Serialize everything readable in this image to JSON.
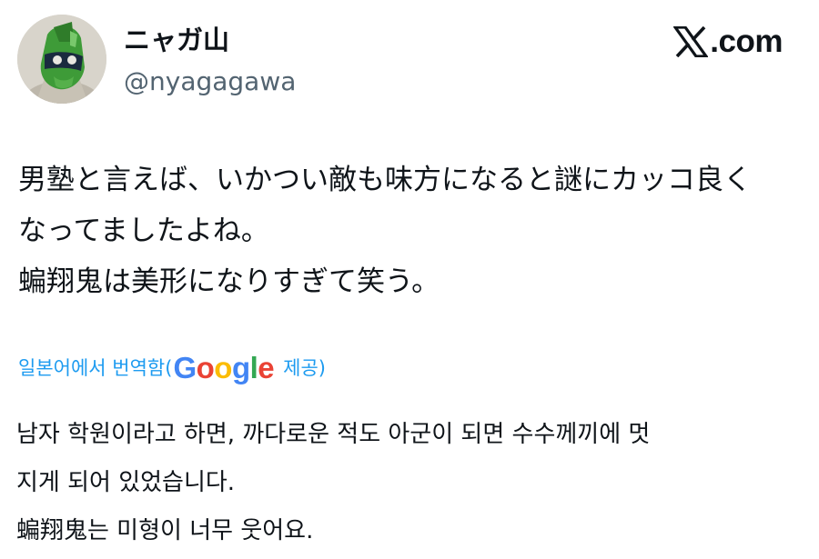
{
  "author": {
    "display_name": "ニャガ山",
    "handle": "@nyagagawa",
    "avatar_icon": "masked-green-figure-avatar"
  },
  "brand": {
    "label": ".com",
    "icon": "x-logo-icon"
  },
  "tweet": {
    "lines": [
      "男塾と言えば、いかつい敵も味方になると謎にカッコ良く",
      "なってましたよね。",
      "蝙翔鬼は美形になりすぎて笑う。"
    ]
  },
  "translation": {
    "prefix": "일본어에서 번역함(",
    "provider": "Google",
    "suffix": "제공)",
    "lines": [
      "남자 학원이라고 하면, 까다로운 적도 아군이 되면 수수께끼에 멋",
      "지게 되어 있었습니다.",
      "蝙翔鬼는 미형이 너무 웃어요."
    ],
    "google_colors": [
      "#4285F4",
      "#EA4335",
      "#FBBC05",
      "#4285F4",
      "#34A853",
      "#EA4335"
    ],
    "link_color": "#1d9bf0"
  }
}
